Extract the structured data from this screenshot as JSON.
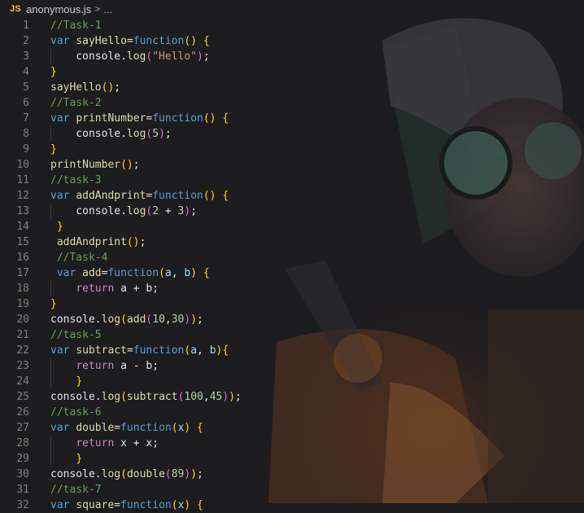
{
  "breadcrumb": {
    "badge": "JS",
    "file": "anonymous.js",
    "separator": ">",
    "more": "..."
  },
  "lines": [
    {
      "n": "1",
      "tokens": [
        [
          "c",
          "//Task-1"
        ]
      ]
    },
    {
      "n": "2",
      "tokens": [
        [
          "k",
          "var"
        ],
        [
          "plain",
          " "
        ],
        [
          "f",
          "sayHello"
        ],
        [
          "plain",
          "="
        ],
        [
          "k",
          "function"
        ],
        [
          "p",
          "()"
        ],
        [
          "plain",
          " "
        ],
        [
          "p",
          "{"
        ]
      ]
    },
    {
      "n": "3",
      "indent": 1,
      "tokens": [
        [
          "plain",
          "    console."
        ],
        [
          "f",
          "log"
        ],
        [
          "p2",
          "("
        ],
        [
          "s",
          "\"Hello\""
        ],
        [
          "p2",
          ")"
        ],
        [
          "plain",
          ";"
        ]
      ]
    },
    {
      "n": "4",
      "tokens": [
        [
          "p",
          "}"
        ]
      ]
    },
    {
      "n": "5",
      "tokens": [
        [
          "f",
          "sayHello"
        ],
        [
          "p",
          "()"
        ],
        [
          "plain",
          ";"
        ]
      ]
    },
    {
      "n": "6",
      "tokens": [
        [
          "c",
          "//Task-2"
        ]
      ]
    },
    {
      "n": "7",
      "tokens": [
        [
          "k",
          "var"
        ],
        [
          "plain",
          " "
        ],
        [
          "f",
          "printNumber"
        ],
        [
          "plain",
          "="
        ],
        [
          "k",
          "function"
        ],
        [
          "p",
          "()"
        ],
        [
          "plain",
          " "
        ],
        [
          "p",
          "{"
        ]
      ]
    },
    {
      "n": "8",
      "indent": 1,
      "tokens": [
        [
          "plain",
          "    console."
        ],
        [
          "f",
          "log"
        ],
        [
          "p2",
          "("
        ],
        [
          "n",
          "5"
        ],
        [
          "p2",
          ")"
        ],
        [
          "plain",
          ";"
        ]
      ]
    },
    {
      "n": "9",
      "tokens": [
        [
          "p",
          "}"
        ]
      ]
    },
    {
      "n": "10",
      "tokens": [
        [
          "f",
          "printNumber"
        ],
        [
          "p",
          "()"
        ],
        [
          "plain",
          ";"
        ]
      ]
    },
    {
      "n": "11",
      "tokens": [
        [
          "c",
          "//task-3"
        ]
      ]
    },
    {
      "n": "12",
      "tokens": [
        [
          "k",
          "var"
        ],
        [
          "plain",
          " "
        ],
        [
          "f",
          "addAndprint"
        ],
        [
          "plain",
          "="
        ],
        [
          "k",
          "function"
        ],
        [
          "p",
          "()"
        ],
        [
          "plain",
          " "
        ],
        [
          "p",
          "{"
        ]
      ]
    },
    {
      "n": "13",
      "indent": 1,
      "tokens": [
        [
          "plain",
          "    console."
        ],
        [
          "f",
          "log"
        ],
        [
          "p2",
          "("
        ],
        [
          "n",
          "2"
        ],
        [
          "plain",
          " + "
        ],
        [
          "n",
          "3"
        ],
        [
          "p2",
          ")"
        ],
        [
          "plain",
          ";"
        ]
      ]
    },
    {
      "n": "14",
      "tokens": [
        [
          "plain",
          " "
        ],
        [
          "p",
          "}"
        ]
      ]
    },
    {
      "n": "15",
      "tokens": [
        [
          "plain",
          " "
        ],
        [
          "f",
          "addAndprint"
        ],
        [
          "p",
          "()"
        ],
        [
          "plain",
          ";"
        ]
      ]
    },
    {
      "n": "16",
      "tokens": [
        [
          "plain",
          " "
        ],
        [
          "c",
          "//Task-4"
        ]
      ]
    },
    {
      "n": "17",
      "tokens": [
        [
          "plain",
          " "
        ],
        [
          "k",
          "var"
        ],
        [
          "plain",
          " "
        ],
        [
          "f",
          "add"
        ],
        [
          "plain",
          "="
        ],
        [
          "k",
          "function"
        ],
        [
          "p",
          "("
        ],
        [
          "id",
          "a"
        ],
        [
          "plain",
          ", "
        ],
        [
          "id",
          "b"
        ],
        [
          "p",
          ")"
        ],
        [
          "plain",
          " "
        ],
        [
          "p",
          "{"
        ]
      ]
    },
    {
      "n": "18",
      "indent": 1,
      "tokens": [
        [
          "plain",
          "    "
        ],
        [
          "kr",
          "return"
        ],
        [
          "plain",
          " a + b;"
        ]
      ]
    },
    {
      "n": "19",
      "tokens": [
        [
          "p",
          "}"
        ]
      ]
    },
    {
      "n": "20",
      "tokens": [
        [
          "plain",
          "console."
        ],
        [
          "f",
          "log"
        ],
        [
          "p",
          "("
        ],
        [
          "f",
          "add"
        ],
        [
          "p2",
          "("
        ],
        [
          "n",
          "10"
        ],
        [
          "plain",
          ","
        ],
        [
          "n",
          "30"
        ],
        [
          "p2",
          ")"
        ],
        [
          "p",
          ")"
        ],
        [
          "plain",
          ";"
        ]
      ]
    },
    {
      "n": "21",
      "tokens": [
        [
          "c",
          "//task-5"
        ]
      ]
    },
    {
      "n": "22",
      "tokens": [
        [
          "k",
          "var"
        ],
        [
          "plain",
          " "
        ],
        [
          "f",
          "subtract"
        ],
        [
          "plain",
          "="
        ],
        [
          "k",
          "function"
        ],
        [
          "p",
          "("
        ],
        [
          "id",
          "a"
        ],
        [
          "plain",
          ", "
        ],
        [
          "id",
          "b"
        ],
        [
          "p",
          ")"
        ],
        [
          "p",
          "{"
        ]
      ]
    },
    {
      "n": "23",
      "indent": 1,
      "tokens": [
        [
          "plain",
          "    "
        ],
        [
          "kr",
          "return"
        ],
        [
          "plain",
          " a - b;"
        ]
      ]
    },
    {
      "n": "24",
      "indent": 1,
      "tokens": [
        [
          "plain",
          "    "
        ],
        [
          "p",
          "}"
        ]
      ]
    },
    {
      "n": "25",
      "tokens": [
        [
          "plain",
          "console."
        ],
        [
          "f",
          "log"
        ],
        [
          "p",
          "("
        ],
        [
          "f",
          "subtract"
        ],
        [
          "p2",
          "("
        ],
        [
          "n",
          "100"
        ],
        [
          "plain",
          ","
        ],
        [
          "n",
          "45"
        ],
        [
          "p2",
          ")"
        ],
        [
          "p",
          ")"
        ],
        [
          "plain",
          ";"
        ]
      ]
    },
    {
      "n": "26",
      "tokens": [
        [
          "c",
          "//task-6"
        ]
      ]
    },
    {
      "n": "27",
      "tokens": [
        [
          "k",
          "var"
        ],
        [
          "plain",
          " "
        ],
        [
          "f",
          "double"
        ],
        [
          "plain",
          "="
        ],
        [
          "k",
          "function"
        ],
        [
          "p",
          "("
        ],
        [
          "id",
          "x"
        ],
        [
          "p",
          ")"
        ],
        [
          "plain",
          " "
        ],
        [
          "p",
          "{"
        ]
      ]
    },
    {
      "n": "28",
      "indent": 1,
      "tokens": [
        [
          "plain",
          "    "
        ],
        [
          "kr",
          "return"
        ],
        [
          "plain",
          " x + x;"
        ]
      ]
    },
    {
      "n": "29",
      "indent": 1,
      "tokens": [
        [
          "plain",
          "    "
        ],
        [
          "p",
          "}"
        ]
      ]
    },
    {
      "n": "30",
      "tokens": [
        [
          "plain",
          "console."
        ],
        [
          "f",
          "log"
        ],
        [
          "p",
          "("
        ],
        [
          "f",
          "double"
        ],
        [
          "p2",
          "("
        ],
        [
          "n",
          "89"
        ],
        [
          "p2",
          ")"
        ],
        [
          "p",
          ")"
        ],
        [
          "plain",
          ";"
        ]
      ]
    },
    {
      "n": "31",
      "tokens": [
        [
          "c",
          "//task-7"
        ]
      ]
    },
    {
      "n": "32",
      "tokens": [
        [
          "k",
          "var"
        ],
        [
          "plain",
          " "
        ],
        [
          "f",
          "square"
        ],
        [
          "plain",
          "="
        ],
        [
          "k",
          "function"
        ],
        [
          "p",
          "("
        ],
        [
          "id",
          "x"
        ],
        [
          "p",
          ")"
        ],
        [
          "plain",
          " "
        ],
        [
          "p",
          "{"
        ]
      ]
    }
  ]
}
